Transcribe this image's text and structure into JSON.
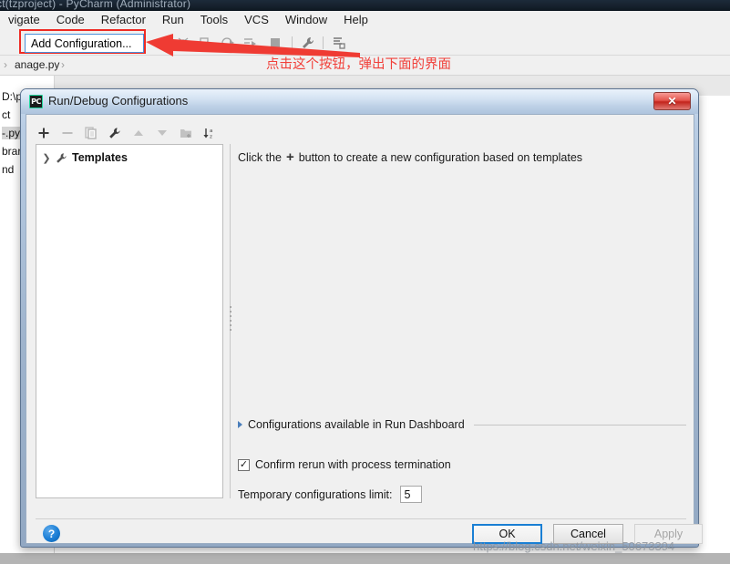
{
  "ide": {
    "window_title": "ct(tzproject) - PyCharm (Administrator)",
    "menus": [
      {
        "label": "vigate"
      },
      {
        "label": "Code"
      },
      {
        "label": "Refactor"
      },
      {
        "label": "Run"
      },
      {
        "label": "Tools"
      },
      {
        "label": "VCS"
      },
      {
        "label": "Window"
      },
      {
        "label": "Help"
      }
    ],
    "add_configuration": {
      "label": "Add Configuration...",
      "highlight_color": "#ee2b24",
      "focus_color": "#4a90d9"
    },
    "toolbar_icons": [
      "run-icon",
      "debug-icon",
      "run-coverage-icon",
      "profile-icon",
      "run-with-console-icon",
      "stop-icon",
      "settings-wrench-icon",
      "db-sync-icon"
    ],
    "breadcrumb": {
      "items": [
        "anage.py"
      ],
      "separator": "›"
    },
    "project_tree_fragments": [
      "D:\\p",
      "ct",
      "-.py",
      "brar",
      "nd"
    ]
  },
  "annotation": {
    "text": "点击这个按钮，弹出下面的界面",
    "color": "#f1403a",
    "arrow_name": "red-pointer-arrow"
  },
  "dialog": {
    "title": "Run/Debug Configurations",
    "app_icon_label": "PC",
    "close_label": "✕",
    "toolbar": [
      {
        "name": "add-configuration-icon",
        "glyph": "+",
        "enabled": true
      },
      {
        "name": "remove-configuration-icon",
        "glyph": "−",
        "enabled": false
      },
      {
        "name": "copy-configuration-icon",
        "glyph": "❐",
        "enabled": false
      },
      {
        "name": "edit-templates-wrench-icon",
        "glyph": "🔧",
        "enabled": true
      },
      {
        "name": "move-up-icon",
        "glyph": "▲",
        "enabled": false
      },
      {
        "name": "move-down-icon",
        "glyph": "▼",
        "enabled": false
      },
      {
        "name": "move-into-folder-icon",
        "glyph": "❐",
        "enabled": false
      },
      {
        "name": "sort-alphabetically-icon",
        "glyph": "↓",
        "enabled": true
      }
    ],
    "tree": {
      "nodes": [
        {
          "label": "Templates",
          "toggle": "❯",
          "icon": "wrench-icon",
          "expanded": false
        }
      ]
    },
    "hint": {
      "prefix": "Click the",
      "plus": "+",
      "suffix": "button to create a new configuration based on templates"
    },
    "run_dashboard": {
      "label": "Configurations available in Run Dashboard",
      "expanded": false
    },
    "confirm_rerun": {
      "label": "Confirm rerun with process termination",
      "checked": true,
      "check_glyph": "✓"
    },
    "temporary_limit": {
      "label": "Temporary configurations limit:",
      "value": "5"
    },
    "footer": {
      "help_label": "?",
      "ok_label": "OK",
      "cancel_label": "Cancel",
      "apply_label": "Apply",
      "apply_enabled": false,
      "focus_color": "#1a7fd4"
    }
  },
  "watermark": {
    "text": "https://blog.csdn.net/weixin_50673394"
  }
}
